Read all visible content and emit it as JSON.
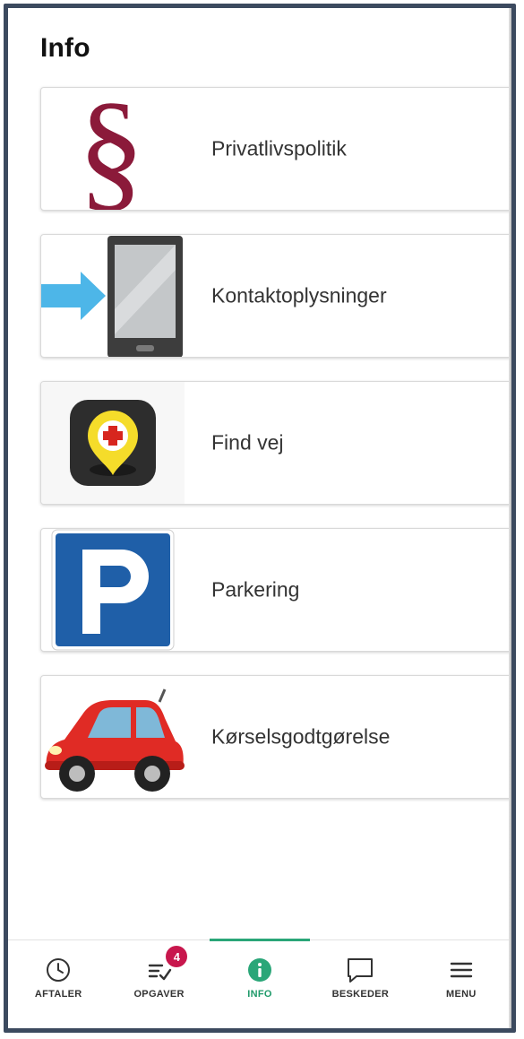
{
  "page": {
    "title": "Info"
  },
  "items": [
    {
      "label": "Privatlivspolitik",
      "icon": "paragraph-icon"
    },
    {
      "label": "Kontaktoplysninger",
      "icon": "phone-arrow-icon"
    },
    {
      "label": "Find vej",
      "icon": "map-pin-cross-icon"
    },
    {
      "label": "Parkering",
      "icon": "parking-sign-icon"
    },
    {
      "label": "Kørselsgodtgørelse",
      "icon": "car-icon"
    }
  ],
  "tabs": [
    {
      "label": "AFTALER",
      "icon": "clock-icon"
    },
    {
      "label": "OPGAVER",
      "icon": "tasks-icon",
      "badge": "4"
    },
    {
      "label": "INFO",
      "icon": "info-icon",
      "active": true
    },
    {
      "label": "BESKEDER",
      "icon": "chat-icon"
    },
    {
      "label": "MENU",
      "icon": "hamburger-icon"
    }
  ],
  "colors": {
    "accent": "#2aa678",
    "badge": "#c8174d",
    "paragraph": "#8b1a3a",
    "parking": "#1f5fa8",
    "car": "#e02b25"
  }
}
